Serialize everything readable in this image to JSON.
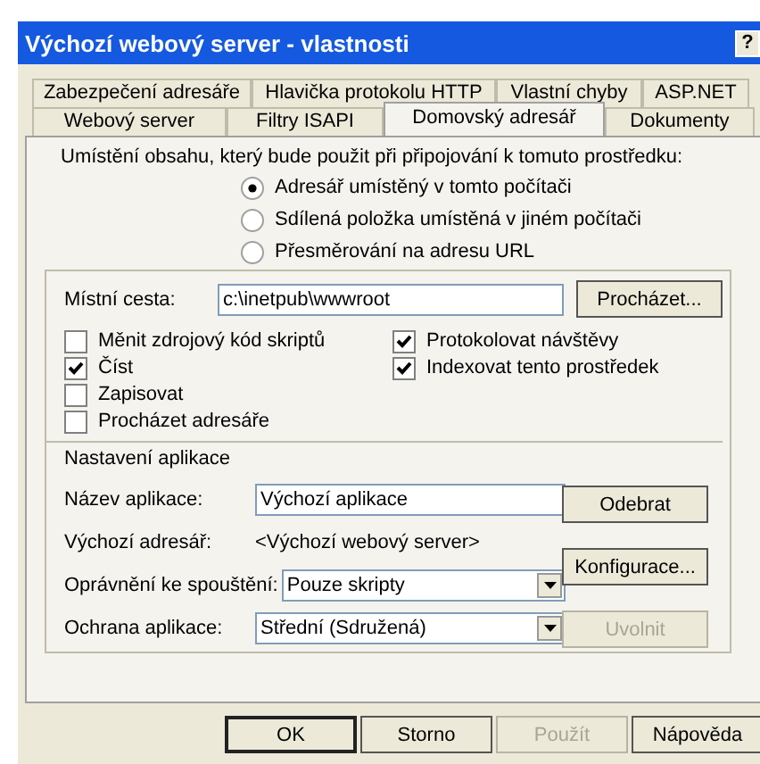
{
  "window": {
    "title": "Výchozí webový server - vlastnosti",
    "help_button": "?"
  },
  "tab_rows": [
    [
      {
        "label": "Zabezpečení adresáře",
        "selected": false
      },
      {
        "label": "Hlavička protokolu HTTP",
        "selected": false
      },
      {
        "label": "Vlastní chyby",
        "selected": false
      },
      {
        "label": "ASP.NET",
        "selected": false
      }
    ],
    [
      {
        "label": "Webový server",
        "selected": false
      },
      {
        "label": "Filtry ISAPI",
        "selected": false
      },
      {
        "label": "Domovský adresář",
        "selected": true
      },
      {
        "label": "Dokumenty",
        "selected": false
      }
    ]
  ],
  "source_prompt": "Umístění obsahu, který bude použit při připojování k tomuto prostředku:",
  "source_options": [
    {
      "label": "Adresář umístěný v tomto počítači",
      "selected": true
    },
    {
      "label": "Sdílená položka umístěná v jiném počítači",
      "selected": false
    },
    {
      "label": "Přesměrování na adresu URL",
      "selected": false
    }
  ],
  "local_path": {
    "label": "Místní cesta:",
    "value": "c:\\inetpub\\wwwroot",
    "button": "Procházet..."
  },
  "permissions_left": [
    {
      "label": "Měnit zdrojový kód skriptů",
      "checked": false
    },
    {
      "label": "Číst",
      "checked": true
    },
    {
      "label": "Zapisovat",
      "checked": false
    },
    {
      "label": "Procházet adresáře",
      "checked": false
    }
  ],
  "permissions_right": [
    {
      "label": "Protokolovat návštěvy",
      "checked": true
    },
    {
      "label": "Indexovat tento prostředek",
      "checked": true
    }
  ],
  "app_settings": {
    "heading": "Nastavení aplikace",
    "name": {
      "label": "Název aplikace:",
      "value": "Výchozí aplikace"
    },
    "remove_button": "Odebrat",
    "start_dir": {
      "label": "Výchozí adresář:",
      "value": "<Výchozí webový server>"
    },
    "configure_button": "Konfigurace...",
    "execute": {
      "label": "Oprávnění ke spouštění:",
      "value": "Pouze skripty"
    },
    "protection": {
      "label": "Ochrana aplikace:",
      "value": "Střední (Sdružená)"
    },
    "unload_button": {
      "label": "Uvolnit",
      "disabled": true
    }
  },
  "buttons": [
    {
      "label": "OK",
      "disabled": false,
      "default": true
    },
    {
      "label": "Storno",
      "disabled": false,
      "default": false
    },
    {
      "label": "Použít",
      "disabled": true,
      "default": false
    },
    {
      "label": "Nápověda",
      "disabled": false,
      "default": false
    }
  ]
}
